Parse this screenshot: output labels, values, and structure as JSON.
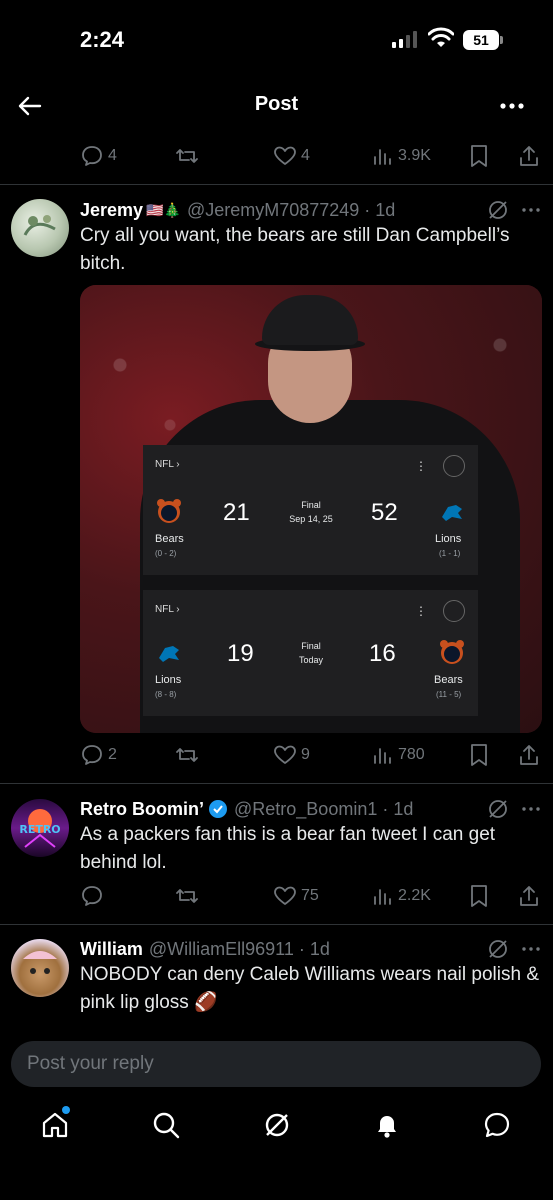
{
  "status_bar": {
    "time": "2:24",
    "battery": "51"
  },
  "header": {
    "title": "Post"
  },
  "top_actions": {
    "replies": "4",
    "likes": "4",
    "views": "3.9K"
  },
  "tweets": [
    {
      "name": "Jeremy",
      "flags": "🇺🇸🎄",
      "handle": "@JeremyM70877249 · 1d",
      "text": "Cry all you want, the bears are still Dan Campbell’s bitch.",
      "replies": "2",
      "likes": "9",
      "views": "780",
      "media": {
        "cards": [
          {
            "league": "NFL ›",
            "home_team": "Bears",
            "home_record": "(0 - 2)",
            "home_score": "21",
            "status": "Final",
            "date": "Sep 14, 25",
            "away_score": "52",
            "away_team": "Lions",
            "away_record": "(1 - 1)"
          },
          {
            "league": "NFL ›",
            "home_team": "Lions",
            "home_record": "(8 - 8)",
            "home_score": "19",
            "status": "Final",
            "date": "Today",
            "away_score": "16",
            "away_team": "Bears",
            "away_record": "(11 - 5)"
          }
        ]
      }
    },
    {
      "name": "Retro Boomin’",
      "handle": "@Retro_Boomin1 · 1d",
      "avatar_text": "RETRO",
      "text": "As a packers fan this is a bear fan tweet I can get behind lol.",
      "likes": "75",
      "views": "2.2K"
    },
    {
      "name": "William",
      "handle": "@WilliamEll96911 · 1d",
      "text": "NOBODY can deny Caleb Williams wears nail polish & pink lip gloss 🏈"
    }
  ],
  "reply_box": {
    "placeholder": "Post your reply"
  },
  "colors": {
    "accent": "#1d9bf0",
    "background": "#000000",
    "muted": "#71767b"
  }
}
